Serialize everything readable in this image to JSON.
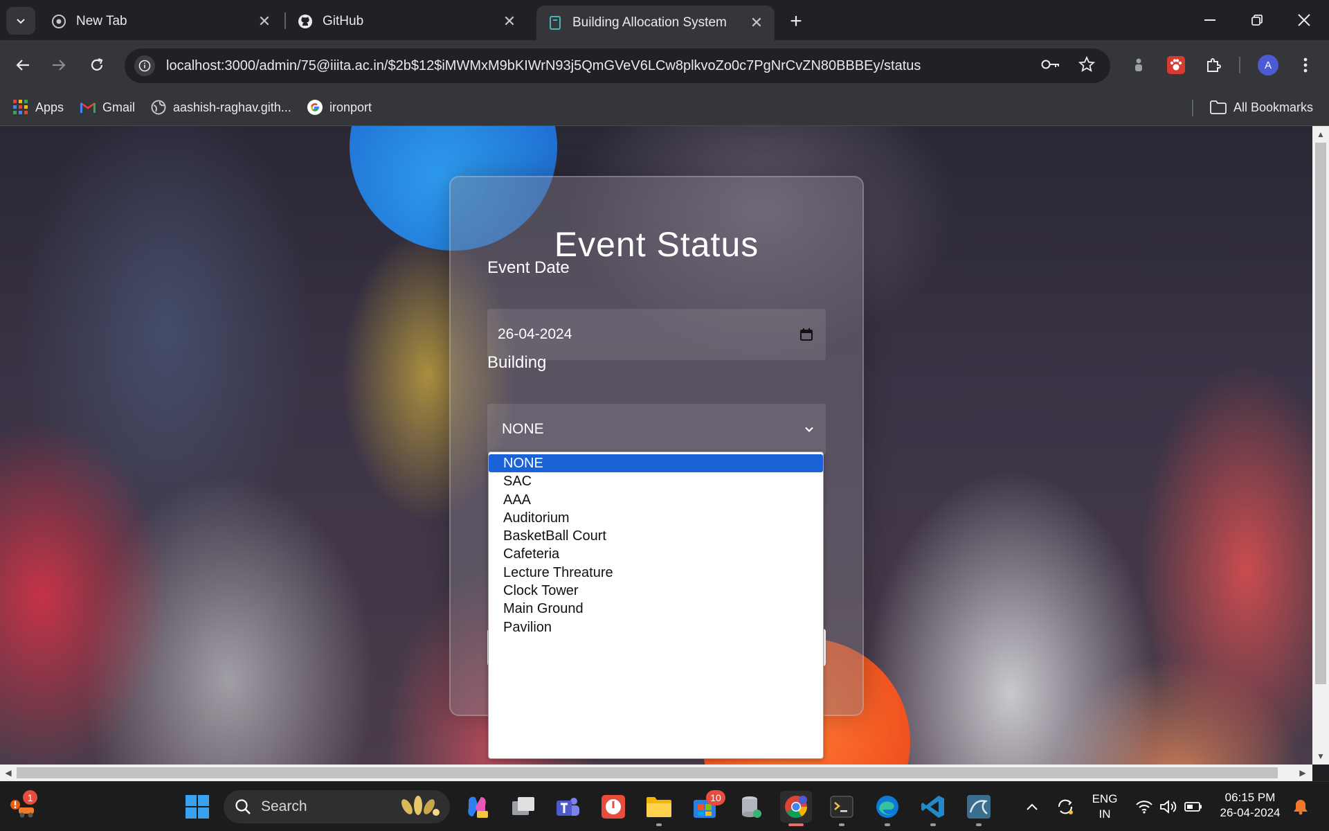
{
  "browser": {
    "tabs": [
      {
        "title": "New Tab",
        "active": false
      },
      {
        "title": "GitHub",
        "active": false
      },
      {
        "title": "Building Allocation System",
        "active": true
      }
    ],
    "url": "localhost:3000/admin/75@iiita.ac.in/$2b$12$iMWMxM9bKIWrN93j5QmGVeV6LCw8plkvoZo0c7PgNrCvZN80BBBEy/status",
    "profile_initial": "A",
    "bookmarks": [
      {
        "label": "Apps",
        "icon": "apps-grid-icon"
      },
      {
        "label": "Gmail",
        "icon": "gmail-icon"
      },
      {
        "label": "aashish-raghav.gith...",
        "icon": "globe-icon"
      },
      {
        "label": "ironport",
        "icon": "google-icon"
      }
    ],
    "all_bookmarks_label": "All Bookmarks"
  },
  "page": {
    "title": "Event Status",
    "event_date_label": "Event Date",
    "event_date_value": "26-04-2024",
    "building_label": "Building",
    "building_selected": "NONE",
    "building_options": [
      "NONE",
      "SAC",
      "AAA",
      "Auditorium",
      "BasketBall Court",
      "Cafeteria",
      "Lecture Threature",
      "Clock Tower",
      "Main Ground",
      "Pavilion"
    ]
  },
  "taskbar": {
    "search_label": "Search",
    "notification_count": "1",
    "teams_badge": "10",
    "language": "ENG",
    "region": "IN",
    "time": "06:15 PM",
    "date": "26-04-2024"
  },
  "colors": {
    "selected_option": "#1a62d5",
    "chrome_dark": "#202124",
    "toolbar": "#35363a"
  }
}
